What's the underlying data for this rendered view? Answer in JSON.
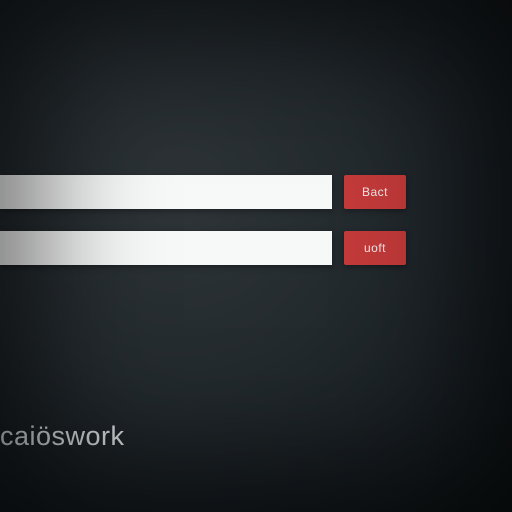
{
  "form": {
    "rows": [
      {
        "value": "",
        "placeholder": "",
        "button_label": "Bact"
      },
      {
        "value": "",
        "placeholder": "",
        "button_label": "uoft"
      }
    ]
  },
  "brand": {
    "text": "caiöswork"
  },
  "colors": {
    "accent": "#c33a3a",
    "input_bg": "#f7f8f8",
    "bg_center": "#2e3438",
    "bg_edge": "#0e1315",
    "text_light": "#dfe3e4"
  }
}
